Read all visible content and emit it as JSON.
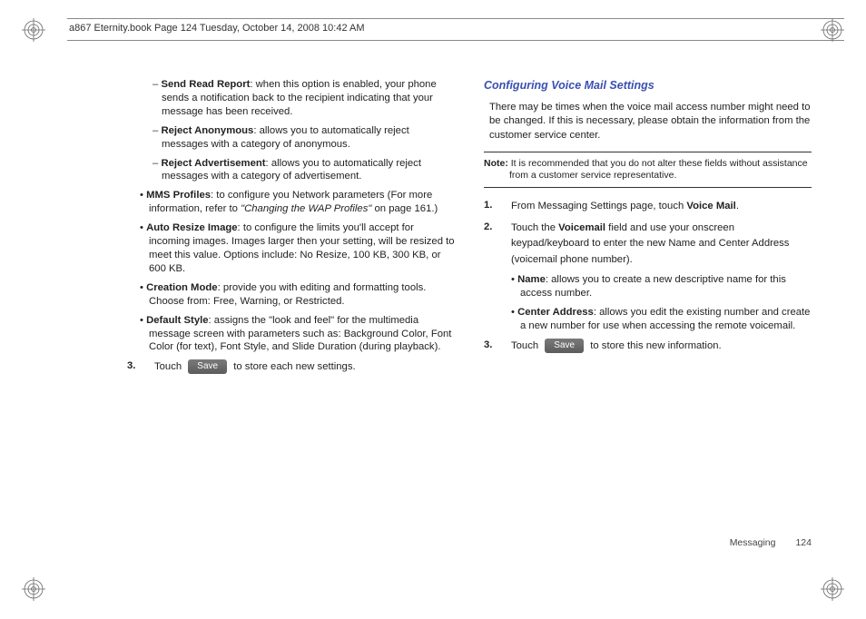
{
  "header": "a867 Eternity.book  Page 124  Tuesday, October 14, 2008  10:42 AM",
  "left": {
    "sendRead": {
      "title": "Send Read Report",
      "body": ": when this option is enabled, your phone sends a notification back to the recipient indicating that your message has been received."
    },
    "rejectAnon": {
      "title": "Reject Anonymous",
      "body": ": allows you to automatically reject messages with a category of anonymous."
    },
    "rejectAd": {
      "title": "Reject Advertisement",
      "body": ": allows you to automatically reject messages with a category of advertisement."
    },
    "mms": {
      "title": "MMS Profiles",
      "body1": ": to configure you Network parameters (For more information, refer to ",
      "ref": "\"Changing the WAP Profiles\"",
      "body2": "  on page 161.)"
    },
    "autoResize": {
      "title": "Auto Resize Image",
      "body": ": to configure the limits you'll accept for incoming images. Images larger then your setting, will be resized to meet this value. Options include: No Resize, 100 KB, 300 KB, or 600 KB."
    },
    "creation": {
      "title": "Creation Mode",
      "body": ": provide you with editing and formatting tools. Choose from: Free, Warning, or Restricted."
    },
    "defaultStyle": {
      "title": "Default Style",
      "body": ": assigns the \"look and feel\" for the multimedia message screen with parameters such as: Background Color, Font Color (for text), Font Style, and Slide Duration (during playback)."
    },
    "step3": {
      "num": "3.",
      "pre": "Touch ",
      "btn": "Save",
      "post": " to store each new settings."
    }
  },
  "right": {
    "heading": "Configuring Voice Mail Settings",
    "intro": "There may be times when the voice mail access number might need to be changed. If this is necessary, please obtain the information from the customer service center.",
    "noteLabel": "Note:",
    "noteBody1": " It is recommended that you do not alter these fields without assistance",
    "noteBody2": "from a customer service representative.",
    "s1": {
      "num": "1.",
      "pre": "From Messaging Settings page, touch ",
      "bold": "Voice Mail",
      "post": "."
    },
    "s2": {
      "num": "2.",
      "pre": "Touch the ",
      "bold": "Voicemail",
      "post": " field and use your onscreen keypad/keyboard to enter the new Name and Center Address (voicemail phone number)."
    },
    "name": {
      "title": "Name",
      "body": ": allows you to create a new descriptive name for this access number."
    },
    "center": {
      "title": "Center Address",
      "body": ": allows you edit the existing number and create a new number for use when accessing the remote voicemail."
    },
    "s3": {
      "num": "3.",
      "pre": "Touch ",
      "btn": "Save",
      "post": " to store this new information."
    }
  },
  "footer": {
    "section": "Messaging",
    "page": "124"
  }
}
